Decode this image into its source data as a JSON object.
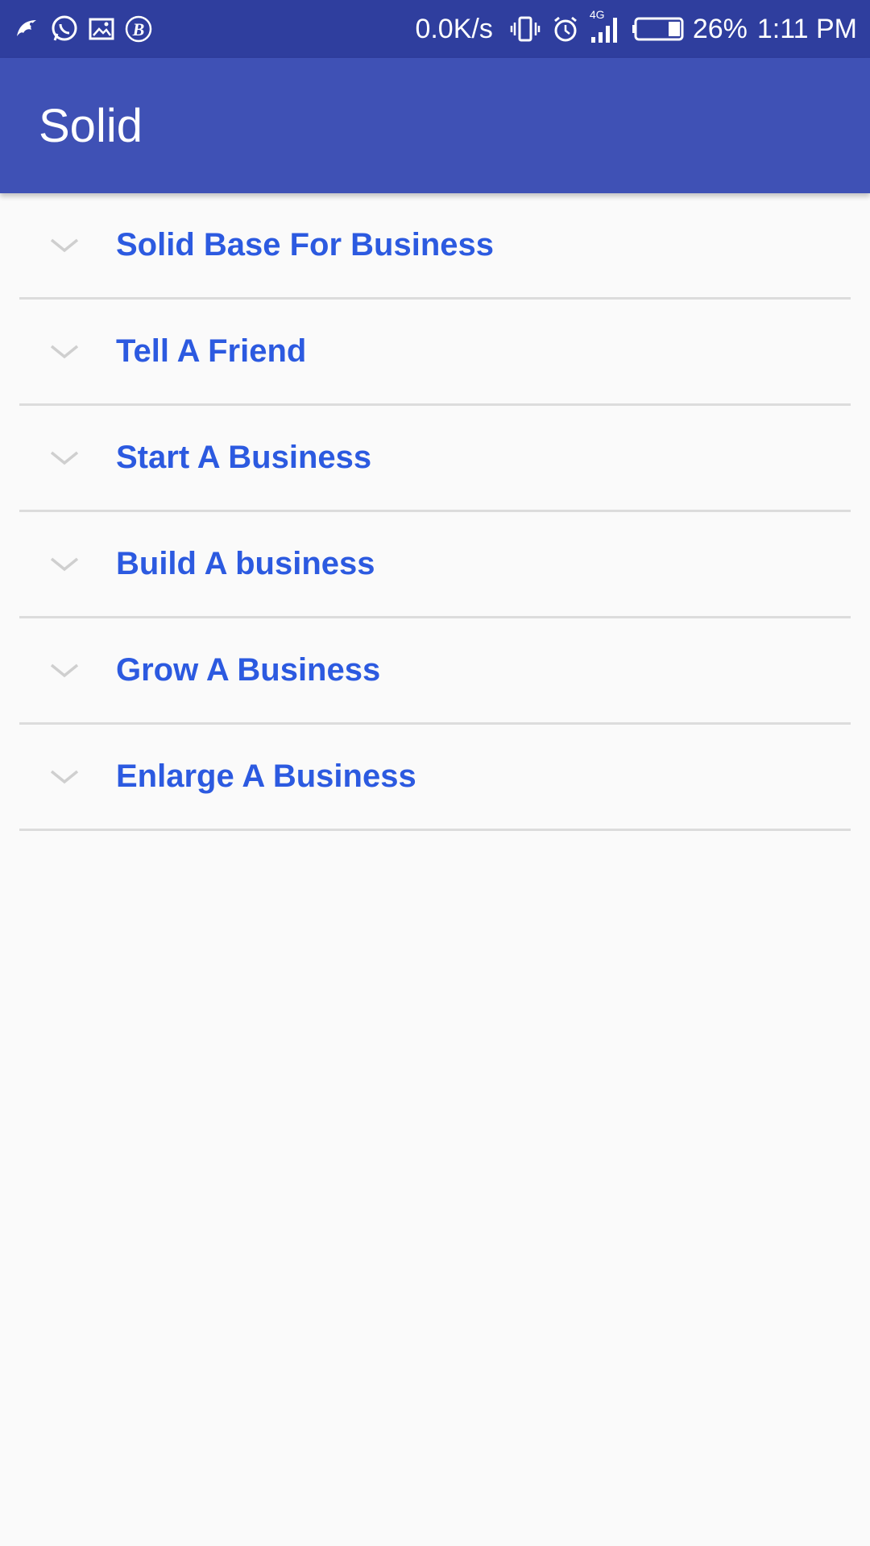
{
  "status_bar": {
    "left_icons": [
      "bird-app-icon",
      "whatsapp-icon",
      "gallery-icon",
      "b-circle-icon"
    ],
    "net_speed": "0.0K/s",
    "network_type": "4G",
    "battery_percent": "26%",
    "battery_level": 0.26,
    "time": "1:11 PM"
  },
  "app_bar": {
    "title": "Solid",
    "color": "#3f51b5",
    "status_color": "#2f3e9e"
  },
  "list": {
    "label_color": "#2c5ae0",
    "items": [
      {
        "label": "Solid Base For Business",
        "icon": "chevron-down-icon"
      },
      {
        "label": "Tell A Friend",
        "icon": "chevron-down-icon"
      },
      {
        "label": "Start A Business",
        "icon": "chevron-down-icon"
      },
      {
        "label": "Build A business",
        "icon": "chevron-down-icon"
      },
      {
        "label": "Grow A Business",
        "icon": "chevron-down-icon"
      },
      {
        "label": "Enlarge A Business",
        "icon": "chevron-down-icon"
      }
    ]
  }
}
